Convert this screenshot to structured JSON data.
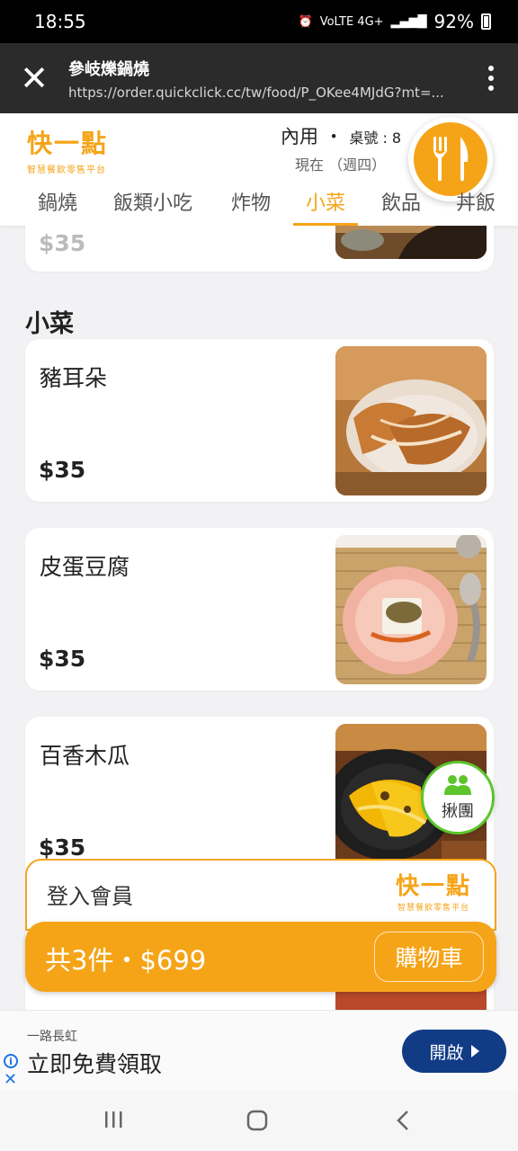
{
  "status_bar": {
    "time": "18:55",
    "net": "VoLTE 4G+",
    "battery": "92%"
  },
  "browser": {
    "title": "參岐爍鍋燒",
    "url": "https://order.quickclick.cc/tw/food/P_OKee4MJdG?mt=..."
  },
  "header": {
    "logo_main": "快一點",
    "logo_sub": "智慧餐飲零售平台",
    "dine_mode": "內用",
    "table_label": "桌號 : 8",
    "now_label": "現在 （週四）"
  },
  "tabs": [
    {
      "label": "鍋燒",
      "active": false
    },
    {
      "label": "飯類小吃",
      "active": false
    },
    {
      "label": "炸物",
      "active": false
    },
    {
      "label": "小菜",
      "active": true
    },
    {
      "label": "飲品",
      "active": false
    },
    {
      "label": "丼飯",
      "active": false
    }
  ],
  "section_title": "小菜",
  "prev_item": {
    "price": "$35"
  },
  "items": [
    {
      "name": "豬耳朵",
      "price": "$35"
    },
    {
      "name": "皮蛋豆腐",
      "price": "$35"
    },
    {
      "name": "百香木瓜",
      "price": "$35"
    }
  ],
  "group_button": {
    "label": "揪團"
  },
  "cart": {
    "login_label": "登入會員",
    "logo_main": "快一點",
    "logo_sub": "智慧餐飲零售平台",
    "summary": "共3件・$699",
    "button_label": "購物車"
  },
  "ad": {
    "brand": "一路長虹",
    "headline": "立即免費領取",
    "button": "開啟"
  },
  "colors": {
    "accent": "#f5a418",
    "group": "#5bc52b",
    "ad_button": "#123b86"
  }
}
